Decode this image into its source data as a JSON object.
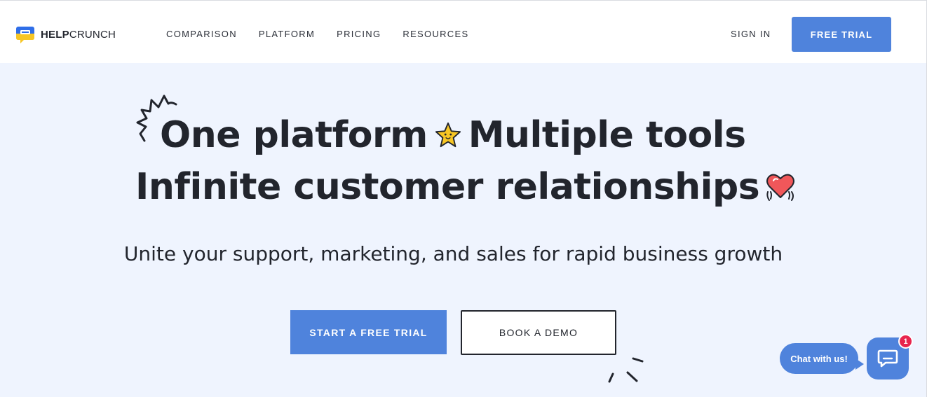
{
  "brand": {
    "name_bold": "HELP",
    "name_light": "CRUNCH",
    "accent_color": "#4f83dc"
  },
  "nav": {
    "items": [
      "COMPARISON",
      "PLATFORM",
      "PRICING",
      "RESOURCES"
    ]
  },
  "header": {
    "sign_in_label": "SIGN IN",
    "free_trial_label": "FREE TRIAL"
  },
  "hero": {
    "headline_line1_a": "One platform",
    "headline_line1_b": "Multiple tools",
    "headline_line2": "Infinite customer relationships",
    "subtitle": "Unite your support, marketing, and sales for rapid business growth",
    "primary_cta": "START A FREE TRIAL",
    "secondary_cta": "BOOK A DEMO",
    "decorations": [
      "squiggle-icon",
      "star-icon",
      "heart-hands-icon",
      "sparks-icon"
    ]
  },
  "chat_widget": {
    "bubble_text": "Chat with us!",
    "badge_count": "1",
    "icon": "chat-icon",
    "badge_color": "#e8254e"
  }
}
